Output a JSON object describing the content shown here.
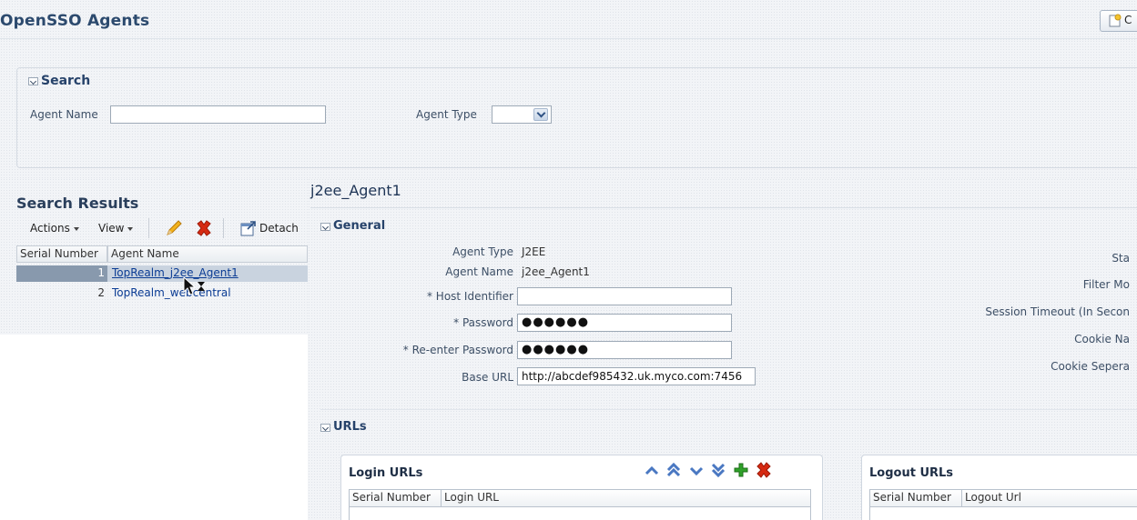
{
  "app": {
    "title": "OpenSSO Agents",
    "create_label": "C"
  },
  "search": {
    "heading": "Search",
    "agent_name_label": "Agent Name",
    "agent_name_value": "",
    "agent_type_label": "Agent Type",
    "agent_type_value": ""
  },
  "results": {
    "title": "Search Results",
    "toolbar": {
      "actions_label": "Actions",
      "view_label": "View",
      "detach_label": "Detach"
    },
    "columns": [
      "Serial Number",
      "Agent Name"
    ],
    "rows": [
      {
        "serial": "1",
        "name": "TopRealm_j2ee_Agent1"
      },
      {
        "serial": "2",
        "name": "TopRealm_webcentral"
      }
    ]
  },
  "detail": {
    "title": "j2ee_Agent1",
    "general_heading": "General",
    "fields": {
      "agent_type_label": "Agent Type",
      "agent_type_value": "J2EE",
      "agent_name_label": "Agent Name",
      "agent_name_value": "j2ee_Agent1",
      "host_identifier_label": "* Host Identifier",
      "host_identifier_value": "",
      "password_label": "* Password",
      "password_value": "●●●●●●",
      "reenter_password_label": "* Re-enter Password",
      "reenter_password_value": "●●●●●●",
      "base_url_label": "Base URL",
      "base_url_value": "http://abcdef985432.uk.myco.com:7456"
    },
    "right_labels": [
      "Sta",
      "Filter Mo",
      "Session Timeout (In Secon",
      "Cookie Na",
      "Cookie Sepera"
    ],
    "urls_heading": "URLs",
    "login_urls": {
      "title": "Login URLs",
      "columns": [
        "Serial Number",
        "Login URL"
      ]
    },
    "logout_urls": {
      "title": "Logout URLs",
      "columns": [
        "Serial Number",
        "Logout Url"
      ]
    }
  },
  "colors": {
    "accent_title": "#2c4a6e",
    "link": "#0b3c94",
    "selected_row": "#c9d3df",
    "delete_red": "#d62a12",
    "add_green": "#2fa12a",
    "move_blue": "#4a78c2"
  }
}
